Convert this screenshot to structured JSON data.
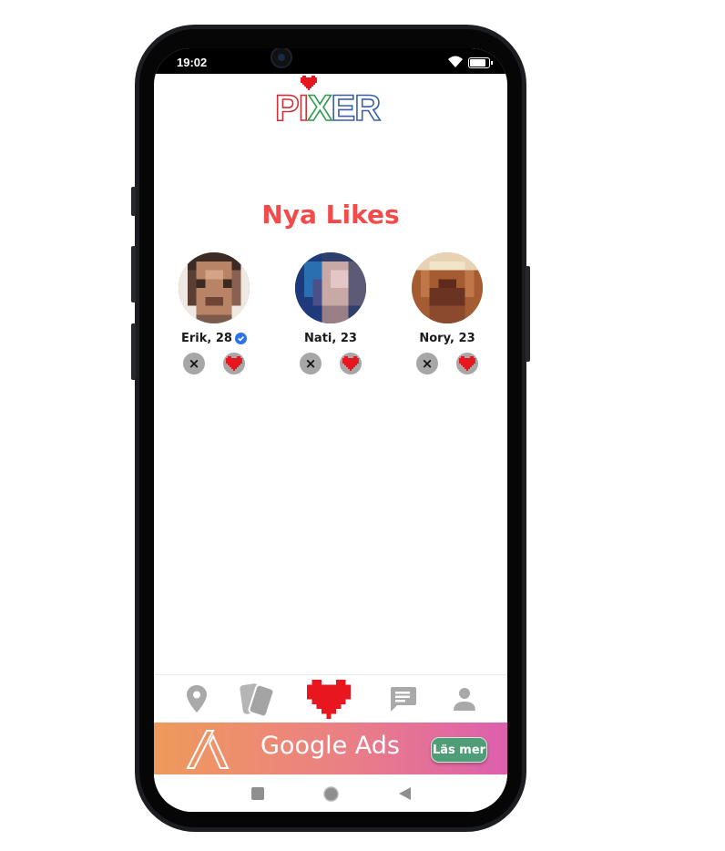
{
  "status_bar": {
    "time": "19:02"
  },
  "app": {
    "logo_text": [
      "P",
      "I",
      "X",
      "E",
      "R"
    ]
  },
  "page": {
    "title": "Nya Likes"
  },
  "likes": [
    {
      "name": "Erik, 28",
      "verified": true
    },
    {
      "name": "Nati, 23",
      "verified": false
    },
    {
      "name": "Nory, 23",
      "verified": false
    }
  ],
  "actions": {
    "dismiss_icon": "×"
  },
  "bottom_nav": [
    "map-pin-icon",
    "cards-icon",
    "heart-icon",
    "chat-icon",
    "profile-icon"
  ],
  "ad": {
    "text": "Google Ads",
    "button_label": "Läs mer"
  },
  "colors": {
    "accent": "#f34a4a",
    "heart": "#e8171f",
    "verified": "#2a73e8"
  }
}
